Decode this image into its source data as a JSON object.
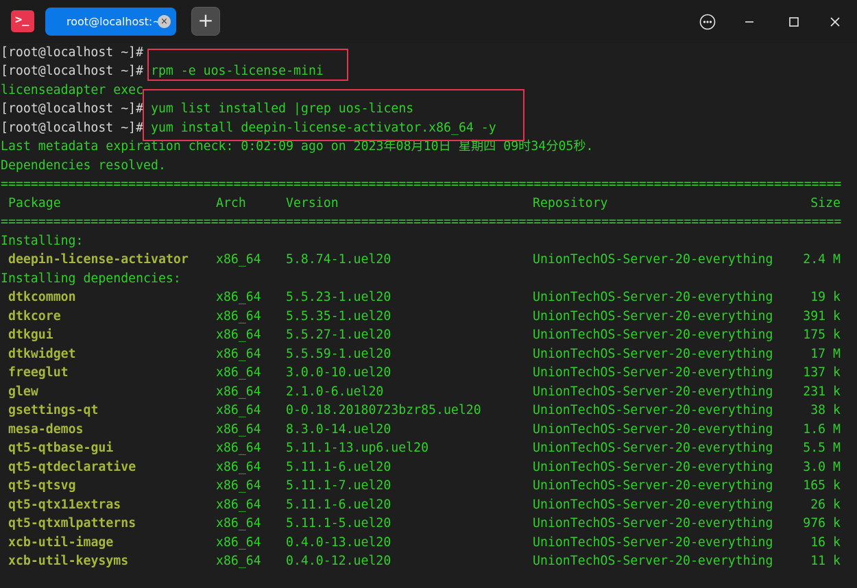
{
  "window": {
    "tab_label": "root@localhost:~",
    "new_tab_label": "+",
    "app_icon_glyph": ">_",
    "icons": [
      "terminal-app-icon",
      "tab-close-icon",
      "plus-icon",
      "more-menu-icon",
      "minimize-icon",
      "maximize-icon",
      "close-icon"
    ]
  },
  "colors": {
    "accent": "#0a78e6",
    "terminal_bg": "#1e1e1e",
    "output_green": "#2fd12a",
    "package_name": "#a8b838",
    "highlight_box": "#e8344f"
  },
  "terminal": {
    "lines": [
      {
        "prompt": "[root@localhost ~]#",
        "command": ""
      },
      {
        "prompt": "[root@localhost ~]#",
        "command": " rpm -e uos-license-mini"
      },
      {
        "text": "licenseadapter exec"
      },
      {
        "prompt": "[root@localhost ~]#",
        "command": " yum list installed |grep uos-licens"
      },
      {
        "prompt": "[root@localhost ~]#",
        "command": " yum install deepin-license-activator.x86_64 -y"
      },
      {
        "text": "Last metadata expiration check: 0:02:09 ago on 2023年08月10日 星期四 09时34分05秒."
      },
      {
        "text": "Dependencies resolved."
      }
    ],
    "separator": "================================================================================================================",
    "table_headers": {
      "package": "Package",
      "arch": "Arch",
      "version": "Version",
      "repository": "Repository",
      "size": "Size"
    },
    "section_installing": "Installing:",
    "section_dependencies": "Installing dependencies:",
    "main_packages": [
      {
        "name": "deepin-license-activator",
        "arch": "x86_64",
        "version": "5.8.74-1.uel20",
        "repo": "UnionTechOS-Server-20-everything",
        "size": "2.4 M"
      }
    ],
    "dependency_packages": [
      {
        "name": "dtkcommon",
        "arch": "x86_64",
        "version": "5.5.23-1.uel20",
        "repo": "UnionTechOS-Server-20-everything",
        "size": "19 k"
      },
      {
        "name": "dtkcore",
        "arch": "x86_64",
        "version": "5.5.35-1.uel20",
        "repo": "UnionTechOS-Server-20-everything",
        "size": "391 k"
      },
      {
        "name": "dtkgui",
        "arch": "x86_64",
        "version": "5.5.27-1.uel20",
        "repo": "UnionTechOS-Server-20-everything",
        "size": "175 k"
      },
      {
        "name": "dtkwidget",
        "arch": "x86_64",
        "version": "5.5.59-1.uel20",
        "repo": "UnionTechOS-Server-20-everything",
        "size": "17 M"
      },
      {
        "name": "freeglut",
        "arch": "x86_64",
        "version": "3.0.0-10.uel20",
        "repo": "UnionTechOS-Server-20-everything",
        "size": "137 k"
      },
      {
        "name": "glew",
        "arch": "x86_64",
        "version": "2.1.0-6.uel20",
        "repo": "UnionTechOS-Server-20-everything",
        "size": "231 k"
      },
      {
        "name": "gsettings-qt",
        "arch": "x86_64",
        "version": "0-0.18.20180723bzr85.uel20",
        "repo": "UnionTechOS-Server-20-everything",
        "size": "38 k"
      },
      {
        "name": "mesa-demos",
        "arch": "x86_64",
        "version": "8.3.0-14.uel20",
        "repo": "UnionTechOS-Server-20-everything",
        "size": "1.6 M"
      },
      {
        "name": "qt5-qtbase-gui",
        "arch": "x86_64",
        "version": "5.11.1-13.up6.uel20",
        "repo": "UnionTechOS-Server-20-everything",
        "size": "5.5 M"
      },
      {
        "name": "qt5-qtdeclarative",
        "arch": "x86_64",
        "version": "5.11.1-6.uel20",
        "repo": "UnionTechOS-Server-20-everything",
        "size": "3.0 M"
      },
      {
        "name": "qt5-qtsvg",
        "arch": "x86_64",
        "version": "5.11.1-7.uel20",
        "repo": "UnionTechOS-Server-20-everything",
        "size": "165 k"
      },
      {
        "name": "qt5-qtx11extras",
        "arch": "x86_64",
        "version": "5.11.1-6.uel20",
        "repo": "UnionTechOS-Server-20-everything",
        "size": "26 k"
      },
      {
        "name": "qt5-qtxmlpatterns",
        "arch": "x86_64",
        "version": "5.11.1-5.uel20",
        "repo": "UnionTechOS-Server-20-everything",
        "size": "976 k"
      },
      {
        "name": "xcb-util-image",
        "arch": "x86_64",
        "version": "0.4.0-13.uel20",
        "repo": "UnionTechOS-Server-20-everything",
        "size": "16 k"
      },
      {
        "name": "xcb-util-keysyms",
        "arch": "x86_64",
        "version": "0.4.0-12.uel20",
        "repo": "UnionTechOS-Server-20-everything",
        "size": "11 k"
      }
    ]
  }
}
